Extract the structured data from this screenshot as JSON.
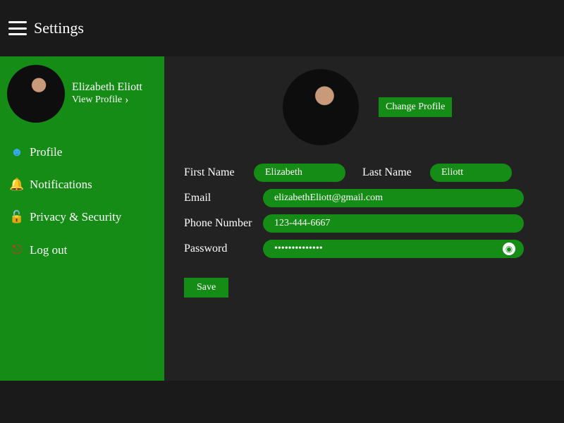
{
  "header": {
    "title": "Settings"
  },
  "sidebar": {
    "user_name": "Elizabeth Eliott",
    "view_profile": "View Profile",
    "items": [
      {
        "icon": "user-icon",
        "label": "Profile"
      },
      {
        "icon": "bell-icon",
        "label": "Notifications"
      },
      {
        "icon": "lock-icon",
        "label": "Privacy & Security"
      },
      {
        "icon": "logout-icon",
        "label": "Log out"
      }
    ]
  },
  "main": {
    "change_profile": "Change Profile",
    "labels": {
      "first_name": "First Name",
      "last_name": "Last Name",
      "email": "Email",
      "phone": "Phone Number",
      "password": "Password"
    },
    "values": {
      "first_name": "Elizabeth",
      "last_name": "Eliott",
      "email": "elizabethEliott@gmail.com",
      "phone": "123-444-6667",
      "password": "••••••••••••••"
    },
    "save": "Save"
  },
  "colors": {
    "accent": "#158c16",
    "bg": "#1a1a1a",
    "panel": "#222222"
  }
}
